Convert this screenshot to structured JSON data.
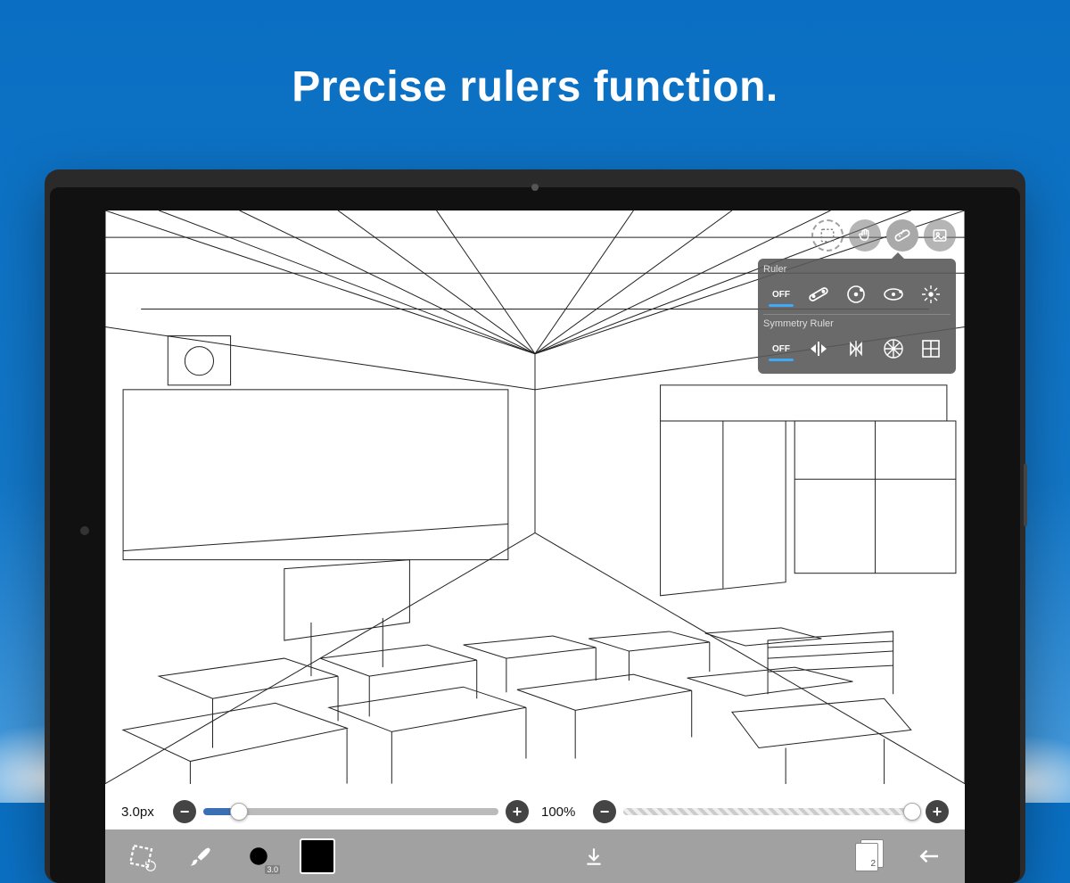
{
  "headline": "Precise rulers function.",
  "popover": {
    "ruler_title": "Ruler",
    "ruler_off": "OFF",
    "symmetry_title": "Symmetry Ruler",
    "symmetry_off": "OFF"
  },
  "sliders": {
    "brush_size_label": "3.0px",
    "brush_size_percent": 12,
    "opacity_label": "100%",
    "opacity_percent": 100
  },
  "toolbar": {
    "brush_badge": "3.0",
    "layer_count": "2"
  }
}
